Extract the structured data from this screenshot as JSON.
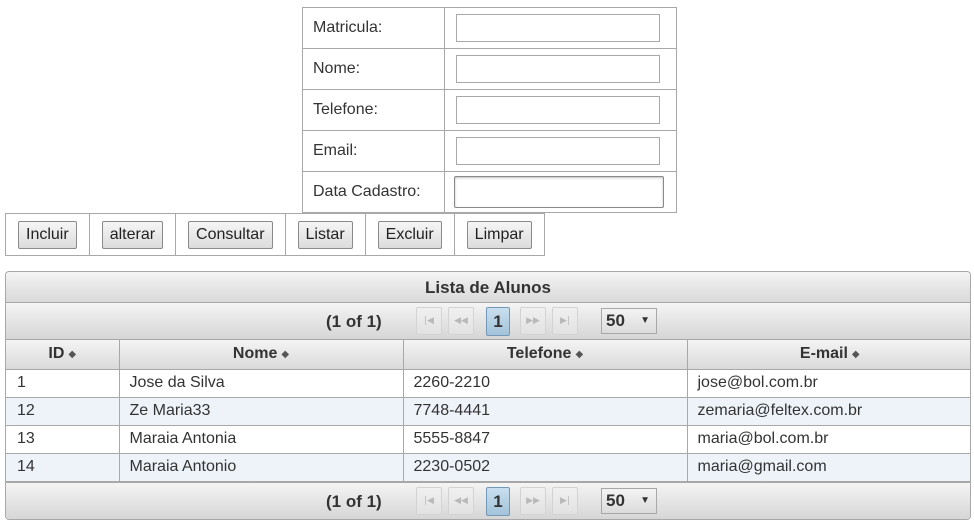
{
  "form": {
    "fields": [
      {
        "label": "Matricula:",
        "value": ""
      },
      {
        "label": "Nome:",
        "value": ""
      },
      {
        "label": "Telefone:",
        "value": ""
      },
      {
        "label": "Email:",
        "value": ""
      },
      {
        "label": "Data Cadastro:",
        "value": ""
      }
    ]
  },
  "buttons": {
    "incluir": "Incluir",
    "alterar": "alterar",
    "consultar": "Consultar",
    "listar": "Listar",
    "excluir": "Excluir",
    "limpar": "Limpar"
  },
  "table": {
    "title": "Lista de Alunos",
    "paginator": {
      "report": "(1 of 1)",
      "current_page": "1",
      "rows_per_page": "50",
      "first_icon": "first-page-icon",
      "prev_icon": "prev-page-icon",
      "next_icon": "next-page-icon",
      "last_icon": "last-page-icon"
    },
    "columns": [
      "ID",
      "Nome",
      "Telefone",
      "E-mail"
    ],
    "rows": [
      [
        "1",
        "Jose da Silva",
        "2260-2210",
        "jose@bol.com.br"
      ],
      [
        "12",
        "Ze Maria33",
        "7748-4441",
        "zemaria@feltex.com.br"
      ],
      [
        "13",
        "Maraia Antonia",
        "5555-8847",
        "maria@bol.com.br"
      ],
      [
        "14",
        "Maraia Antonio",
        "2230-0502",
        "maria@gmail.com"
      ]
    ]
  },
  "colors": {
    "border": "#a8a8a8",
    "header_gradient_top": "#f4f4f4",
    "header_gradient_bottom": "#d9d9d9",
    "active_page": "#a3c3da",
    "alt_row": "#eef3f9"
  }
}
